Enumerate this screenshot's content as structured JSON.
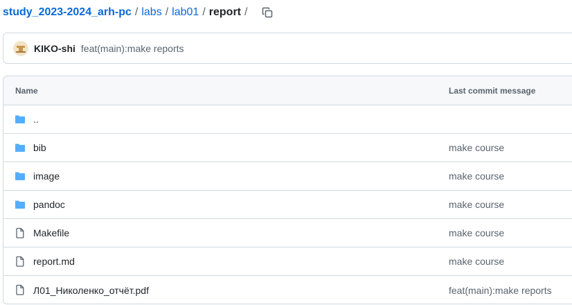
{
  "breadcrumb": {
    "repo": "study_2023-2024_arh-pc",
    "parts": [
      "labs",
      "lab01"
    ],
    "current": "report",
    "separator": "/"
  },
  "commit": {
    "author": "KIKO-shi",
    "message": "feat(main):make reports"
  },
  "table": {
    "headers": {
      "name": "Name",
      "last_commit": "Last commit message"
    },
    "rows": [
      {
        "name": "..",
        "type": "folder",
        "message": ""
      },
      {
        "name": "bib",
        "type": "folder",
        "message": "make course"
      },
      {
        "name": "image",
        "type": "folder",
        "message": "make course"
      },
      {
        "name": "pandoc",
        "type": "folder",
        "message": "make course"
      },
      {
        "name": "Makefile",
        "type": "file",
        "message": "make course"
      },
      {
        "name": "report.md",
        "type": "file",
        "message": "make course"
      },
      {
        "name": "Л01_Николенко_отчёт.pdf",
        "type": "file",
        "message": "feat(main):make reports"
      }
    ]
  },
  "colors": {
    "link": "#0969da",
    "folder_icon": "#54aeff",
    "muted_text": "#59636e",
    "border": "#d1d9e0",
    "header_bg": "#f6f8fa"
  },
  "icons": {
    "copy": "copy-icon",
    "folder": "folder-icon",
    "file": "file-icon"
  }
}
